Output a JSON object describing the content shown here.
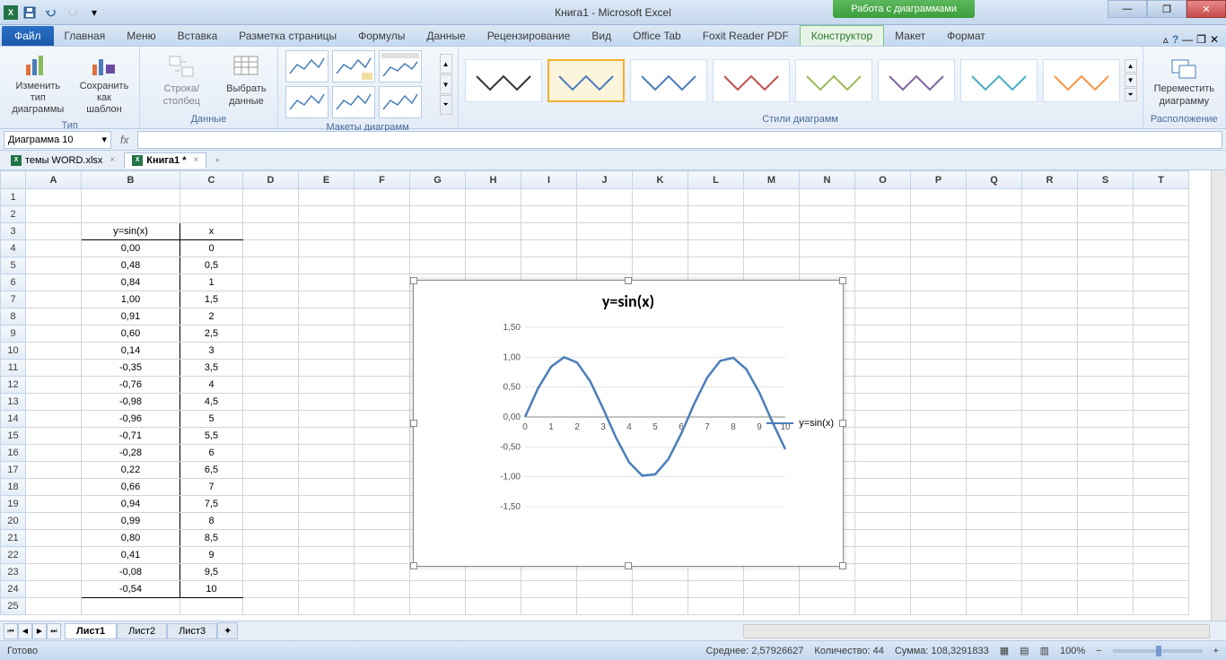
{
  "titlebar": {
    "title": "Книга1 - Microsoft Excel",
    "chart_tools": "Работа с диаграммами"
  },
  "ribbon_tabs": {
    "file": "Файл",
    "tabs": [
      "Главная",
      "Меню",
      "Вставка",
      "Разметка страницы",
      "Формулы",
      "Данные",
      "Рецензирование",
      "Вид",
      "Office Tab",
      "Foxit Reader PDF",
      "Конструктор",
      "Макет",
      "Формат"
    ]
  },
  "ribbon": {
    "type": {
      "change": "Изменить тип\nдиаграммы",
      "save_template": "Сохранить\nкак шаблон",
      "label": "Тип"
    },
    "data": {
      "switch": "Строка/столбец",
      "select": "Выбрать\nданные",
      "label": "Данные"
    },
    "layouts": {
      "label": "Макеты диаграмм"
    },
    "styles": {
      "label": "Стили диаграмм"
    },
    "location": {
      "move": "Переместить\nдиаграмму",
      "label": "Расположение"
    }
  },
  "name_box": "Диаграмма 10",
  "fx": "fx",
  "doc_tabs": {
    "tab1": "темы WORD.xlsx",
    "tab2": "Книга1 *"
  },
  "columns": [
    "A",
    "B",
    "C",
    "D",
    "E",
    "F",
    "G",
    "H",
    "I",
    "J",
    "K",
    "L",
    "M",
    "N",
    "O",
    "P",
    "Q",
    "R",
    "S",
    "T"
  ],
  "rows": [
    "1",
    "2",
    "3",
    "4",
    "5",
    "6",
    "7",
    "8",
    "9",
    "10",
    "11",
    "12",
    "13",
    "14",
    "15",
    "16",
    "17",
    "18",
    "19",
    "20",
    "21",
    "22",
    "23",
    "24",
    "25"
  ],
  "table": {
    "header_b": "y=sin(x)",
    "header_c": "x",
    "data": [
      {
        "b": "0,00",
        "c": "0"
      },
      {
        "b": "0,48",
        "c": "0,5"
      },
      {
        "b": "0,84",
        "c": "1"
      },
      {
        "b": "1,00",
        "c": "1,5"
      },
      {
        "b": "0,91",
        "c": "2"
      },
      {
        "b": "0,60",
        "c": "2,5"
      },
      {
        "b": "0,14",
        "c": "3"
      },
      {
        "b": "-0,35",
        "c": "3,5"
      },
      {
        "b": "-0,76",
        "c": "4"
      },
      {
        "b": "-0,98",
        "c": "4,5"
      },
      {
        "b": "-0,96",
        "c": "5"
      },
      {
        "b": "-0,71",
        "c": "5,5"
      },
      {
        "b": "-0,28",
        "c": "6"
      },
      {
        "b": "0,22",
        "c": "6,5"
      },
      {
        "b": "0,66",
        "c": "7"
      },
      {
        "b": "0,94",
        "c": "7,5"
      },
      {
        "b": "0,99",
        "c": "8"
      },
      {
        "b": "0,80",
        "c": "8,5"
      },
      {
        "b": "0,41",
        "c": "9"
      },
      {
        "b": "-0,08",
        "c": "9,5"
      },
      {
        "b": "-0,54",
        "c": "10"
      }
    ]
  },
  "chart": {
    "title": "y=sin(x)",
    "legend": "y=sin(x)"
  },
  "chart_data": {
    "type": "line",
    "title": "y=sin(x)",
    "xlabel": "",
    "ylabel": "",
    "xlim": [
      0,
      10
    ],
    "ylim": [
      -1.5,
      1.5
    ],
    "y_ticks": [
      -1.5,
      -1.0,
      -0.5,
      0.0,
      0.5,
      1.0,
      1.5
    ],
    "y_tick_labels": [
      "-1,50",
      "-1,00",
      "-0,50",
      "0,00",
      "0,50",
      "1,00",
      "1,50"
    ],
    "x_ticks": [
      0,
      1,
      2,
      3,
      4,
      5,
      6,
      7,
      8,
      9,
      10
    ],
    "series": [
      {
        "name": "y=sin(x)",
        "x": [
          0,
          0.5,
          1,
          1.5,
          2,
          2.5,
          3,
          3.5,
          4,
          4.5,
          5,
          5.5,
          6,
          6.5,
          7,
          7.5,
          8,
          8.5,
          9,
          9.5,
          10
        ],
        "y": [
          0.0,
          0.48,
          0.84,
          1.0,
          0.91,
          0.6,
          0.14,
          -0.35,
          -0.76,
          -0.98,
          -0.96,
          -0.71,
          -0.28,
          0.22,
          0.66,
          0.94,
          0.99,
          0.8,
          0.41,
          -0.08,
          -0.54
        ]
      }
    ]
  },
  "sheet_tabs": [
    "Лист1",
    "Лист2",
    "Лист3"
  ],
  "status": {
    "ready": "Готово",
    "avg": "Среднее: 2,57926627",
    "count": "Количество: 44",
    "sum": "Сумма: 108,3291833",
    "zoom": "100%"
  }
}
